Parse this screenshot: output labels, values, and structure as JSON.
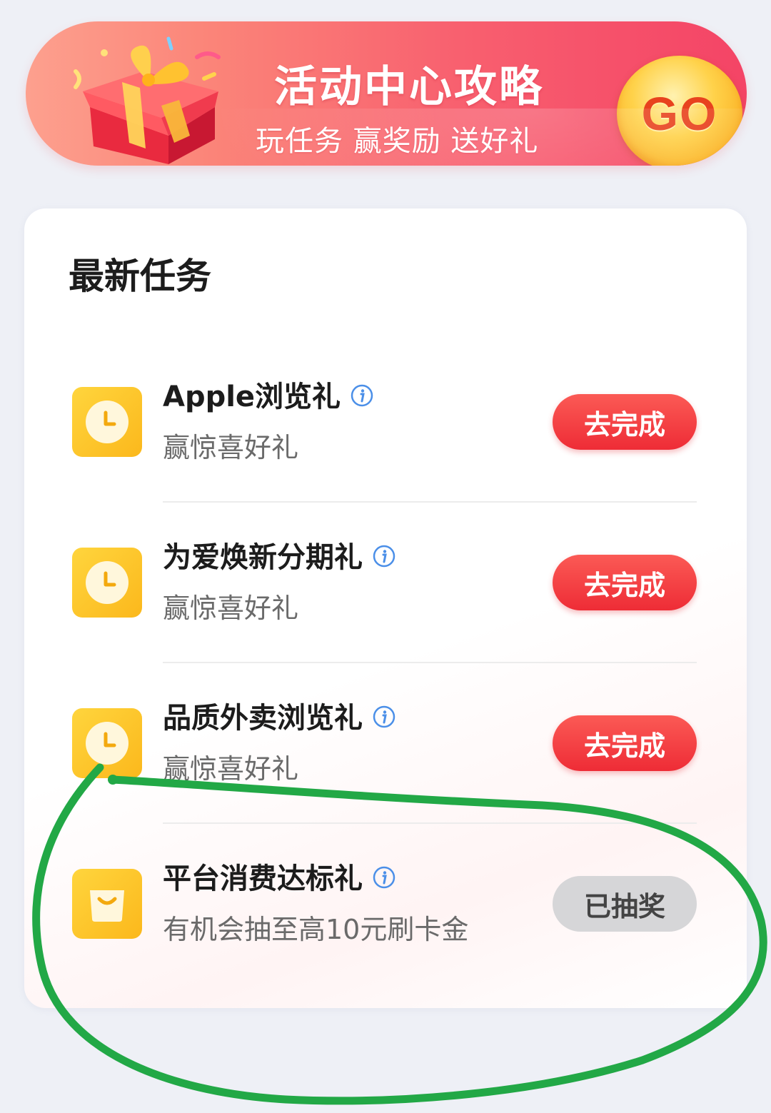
{
  "banner": {
    "title": "活动中心攻略",
    "subtitle": "玩任务 赢奖励 送好礼",
    "go_label": "GO"
  },
  "tasks_section": {
    "title": "最新任务",
    "tasks": [
      {
        "name": "Apple浏览礼",
        "description": "赢惊喜好礼",
        "icon": "clock-icon",
        "button": "去完成",
        "state": "pending"
      },
      {
        "name": "为爱焕新分期礼",
        "description": "赢惊喜好礼",
        "icon": "clock-icon",
        "button": "去完成",
        "state": "pending"
      },
      {
        "name": "品质外卖浏览礼",
        "description": "赢惊喜好礼",
        "icon": "clock-icon",
        "button": "去完成",
        "state": "pending"
      },
      {
        "name": "平台消费达标礼",
        "description": "有机会抽至高10元刷卡金",
        "icon": "shopping-bag-icon",
        "button": "已抽奖",
        "state": "done"
      }
    ]
  },
  "colors": {
    "banner_gradient_start": "#fda08e",
    "banner_gradient_end": "#f44466",
    "go_button": "#ffd24a",
    "action_red": "#ee2c36",
    "action_done_gray": "#d6d6d8",
    "icon_yellow": "#fbb81c",
    "annotation_green": "#22a846"
  }
}
